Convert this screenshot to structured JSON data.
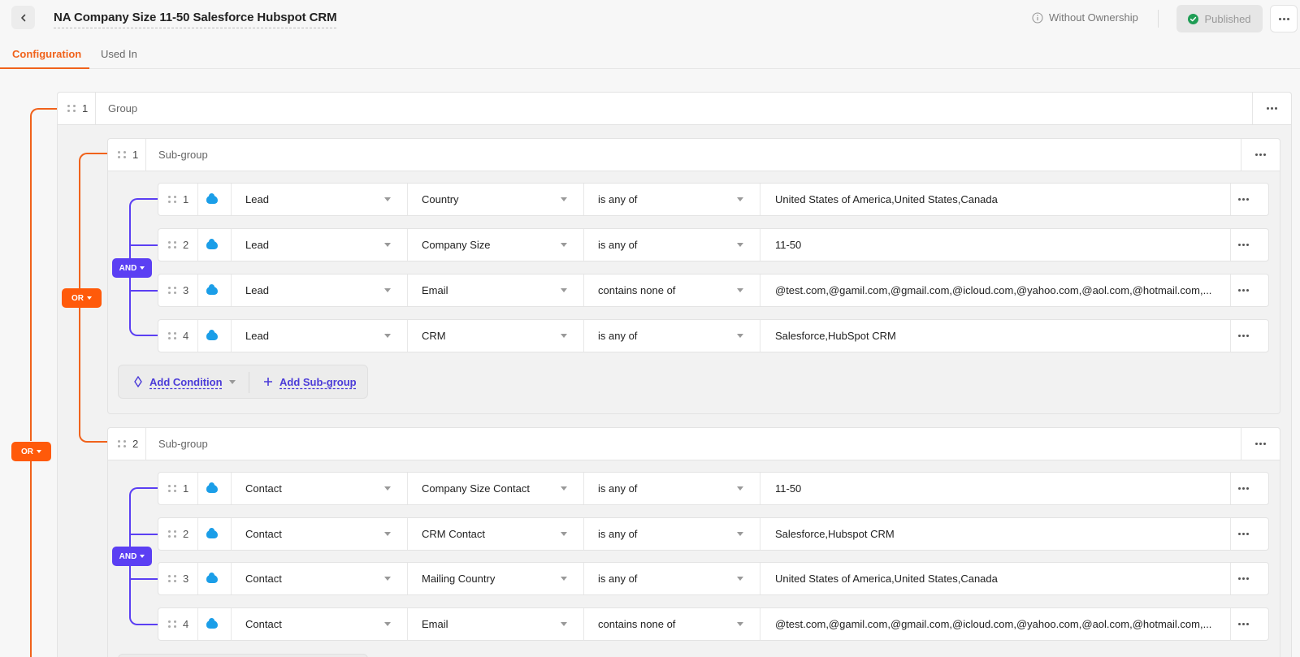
{
  "header": {
    "title": "NA Company Size 11-50 Salesforce Hubspot CRM",
    "ownership": "Without Ownership",
    "status_button": "Published"
  },
  "tabs": [
    {
      "label": "Configuration",
      "active": true
    },
    {
      "label": "Used In",
      "active": false
    }
  ],
  "group": {
    "number": "1",
    "label": "Group",
    "operator": "OR",
    "subgroups": [
      {
        "number": "1",
        "label": "Sub-group",
        "operator": "AND",
        "conditions": [
          {
            "num": "1",
            "object": "Lead",
            "field": "Country",
            "operator": "is any of",
            "value": "United States of America,United States,Canada"
          },
          {
            "num": "2",
            "object": "Lead",
            "field": "Company Size",
            "operator": "is any of",
            "value": "11-50"
          },
          {
            "num": "3",
            "object": "Lead",
            "field": "Email",
            "operator": "contains none of",
            "value": "@test.com,@gamil.com,@gmail.com,@icloud.com,@yahoo.com,@aol.com,@hotmail.com,..."
          },
          {
            "num": "4",
            "object": "Lead",
            "field": "CRM",
            "operator": "is any of",
            "value": "Salesforce,HubSpot CRM"
          }
        ],
        "add_condition": "Add Condition",
        "add_subgroup": "Add Sub-group"
      },
      {
        "number": "2",
        "label": "Sub-group",
        "operator": "AND",
        "conditions": [
          {
            "num": "1",
            "object": "Contact",
            "field": "Company Size Contact",
            "operator": "is any of",
            "value": "11-50"
          },
          {
            "num": "2",
            "object": "Contact",
            "field": "CRM Contact",
            "operator": "is any of",
            "value": "Salesforce,Hubspot CRM"
          },
          {
            "num": "3",
            "object": "Contact",
            "field": "Mailing Country",
            "operator": "is any of",
            "value": "United States of America,United States,Canada"
          },
          {
            "num": "4",
            "object": "Contact",
            "field": "Email",
            "operator": "contains none of",
            "value": "@test.com,@gamil.com,@gmail.com,@icloud.com,@yahoo.com,@aol.com,@hotmail.com,..."
          }
        ]
      }
    ]
  },
  "root_operator": "OR",
  "colors": {
    "accent": "#f0621b",
    "or_badge": "#ff5a0a",
    "and_badge": "#5b3ff3",
    "salesforce": "#1b9ee8"
  },
  "icons": [
    "back-arrow-icon",
    "info-icon",
    "check-circle-icon",
    "more-horizontal-icon",
    "drag-handle-icon",
    "salesforce-icon",
    "chevron-down-icon",
    "add-condition-icon",
    "plus-icon"
  ]
}
